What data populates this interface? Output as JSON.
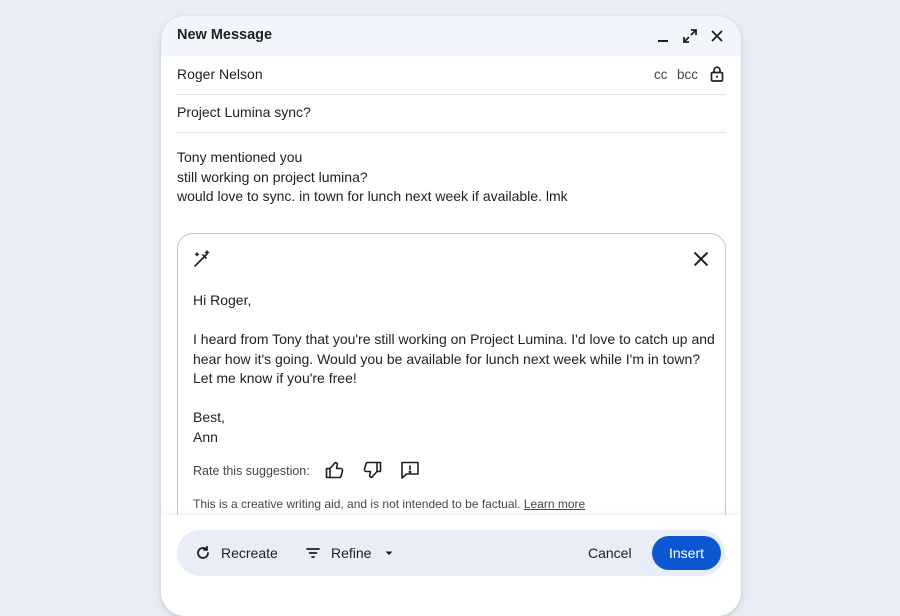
{
  "window": {
    "title": "New Message"
  },
  "compose": {
    "to": "Roger Nelson",
    "cc_label": "cc",
    "bcc_label": "bcc",
    "subject": "Project Lumina sync?",
    "body_lines": [
      "Tony mentioned you",
      "still working on project lumina?",
      "would love to sync. in town for lunch next week if available. lmk"
    ]
  },
  "suggestion": {
    "lines": [
      "Hi Roger,",
      "",
      "I heard from Tony that you're still working on Project Lumina. I'd love to catch up and",
      "hear how it's going. Would you be available for lunch next week while I'm in town?",
      "Let me know if you're free!",
      "",
      "Best,",
      "Ann"
    ],
    "rate_label": "Rate this suggestion:",
    "disclaimer": "This is a creative writing aid, and is not intended to be factual.",
    "learn_more": "Learn more"
  },
  "actions": {
    "recreate": "Recreate",
    "refine": "Refine",
    "cancel": "Cancel",
    "insert": "Insert"
  },
  "colors": {
    "background": "#e9edf6",
    "titlebar": "#f2f5fc",
    "actionbar": "#e8edf7",
    "primary": "#0b57d0"
  },
  "icons": [
    "minimize-icon",
    "expand-icon",
    "close-icon",
    "lock-icon",
    "magic-wand-icon",
    "thumbs-up-icon",
    "thumbs-down-icon",
    "feedback-icon",
    "refresh-icon",
    "filter-icon",
    "caret-down-icon"
  ]
}
